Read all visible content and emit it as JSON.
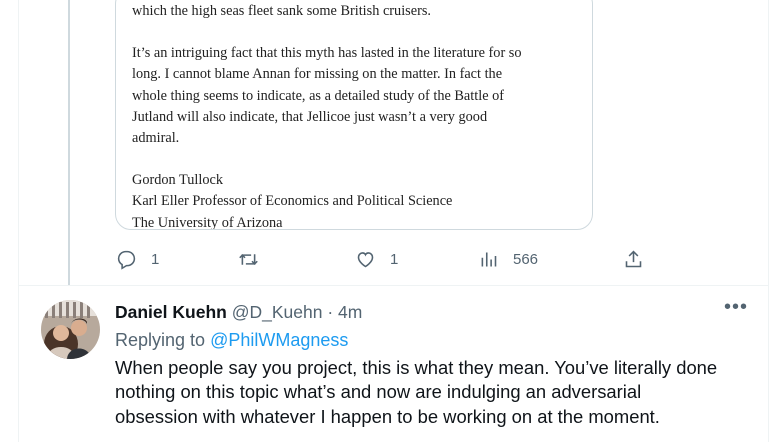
{
  "quoted_letter": {
    "line_top": "which the high seas fleet sank some British cruisers.",
    "paragraph": [
      "It’s an intriguing fact that this myth has lasted in the literature for so",
      "long. I cannot blame Annan for missing on the matter. In fact the",
      "whole thing seems to indicate, as a detailed study of the Battle of",
      "Jutland will also indicate, that Jellicoe just wasn’t a very good",
      "admiral."
    ],
    "signature": [
      "Gordon Tullock",
      "Karl Eller Professor of Economics and Political Science",
      "The University of Arizona"
    ]
  },
  "actions": {
    "reply_count": "1",
    "retweet_count": "",
    "like_count": "1",
    "views_count": "566",
    "icons": [
      "reply-icon",
      "retweet-icon",
      "like-icon",
      "views-icon",
      "share-icon"
    ]
  },
  "reply_tweet": {
    "display_name": "Daniel Kuehn",
    "handle": "@D_Kuehn",
    "separator": "·",
    "time": "4m",
    "more_label": "•••",
    "replying_prefix": "Replying to",
    "replying_to": "@PhilWMagness",
    "text_lines": [
      "When people say you project, this is what they mean. You’ve literally done",
      "nothing on this topic what’s and now are indulging an adversarial",
      "obsession with whatever I happen to be working on at the moment."
    ]
  },
  "colors": {
    "link_blue": "#1d9bf0",
    "secondary_text": "#536471",
    "primary_text": "#0f1419",
    "border": "#cfd9de"
  }
}
